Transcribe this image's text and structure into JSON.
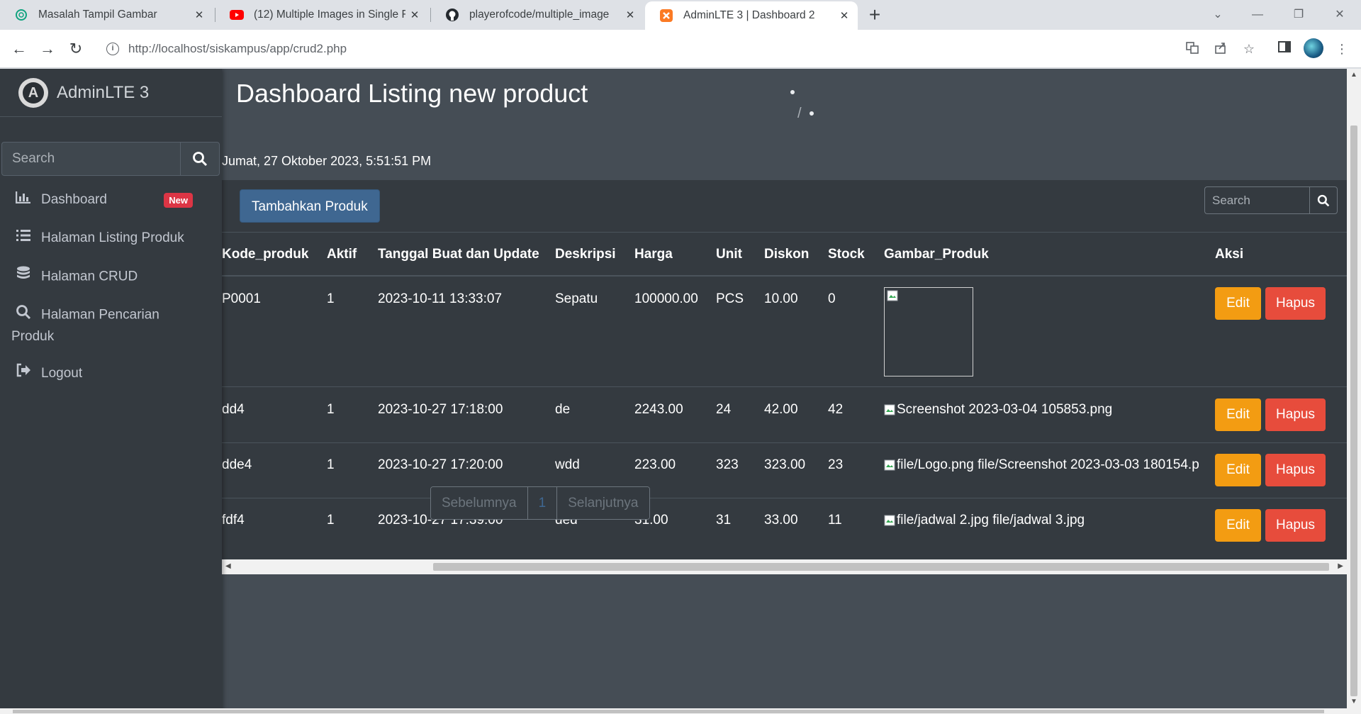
{
  "browser": {
    "tabs": [
      {
        "title": "Masalah Tampil Gambar",
        "icon": "chatgpt-icon"
      },
      {
        "title": "(12) Multiple Images in Single Fi",
        "icon": "youtube-icon"
      },
      {
        "title": "playerofcode/multiple_image",
        "icon": "github-icon"
      },
      {
        "title": "AdminLTE 3 | Dashboard 2",
        "icon": "xampp-icon",
        "active": true
      }
    ],
    "url_host": "http://localhost",
    "url_path": "/siskampus/app/crud2.php"
  },
  "sidebar": {
    "brand": "AdminLTE 3",
    "search_placeholder": "Search",
    "items": [
      {
        "label": "Dashboard",
        "icon": "chart-bar-icon",
        "badge": "New"
      },
      {
        "label": "Halaman Listing Produk",
        "icon": "list-icon"
      },
      {
        "label": "Halaman CRUD",
        "icon": "database-icon"
      },
      {
        "label": "Halaman Pencarian",
        "label2": "Produk",
        "icon": "search-icon"
      },
      {
        "label": "Logout",
        "icon": "sign-out-icon"
      }
    ]
  },
  "main": {
    "title": "Dashboard Listing new product",
    "breadcrumb_sep": "/",
    "datetime": "Jumat, 27 Oktober 2023, 5:51:51 PM",
    "add_button": "Tambahkan Produk",
    "search_placeholder": "Search",
    "columns": [
      "Kode_produk",
      "Aktif",
      "Tanggal Buat dan Update",
      "Deskripsi",
      "Harga",
      "Unit",
      "Diskon",
      "Stock",
      "Gambar_Produk",
      "Aksi"
    ],
    "rows": [
      {
        "kode": "P0001",
        "aktif": "1",
        "tanggal": "2023-10-11 13:33:07",
        "deskripsi": "Sepatu",
        "harga": "100000.00",
        "unit": "PCS",
        "diskon": "10.00",
        "stock": "0",
        "gambar": ""
      },
      {
        "kode": "dd4",
        "aktif": "1",
        "tanggal": "2023-10-27 17:18:00",
        "deskripsi": "de",
        "harga": "2243.00",
        "unit": "24",
        "diskon": "42.00",
        "stock": "42",
        "gambar": "Screenshot 2023-03-04 105853.png"
      },
      {
        "kode": "dde4",
        "aktif": "1",
        "tanggal": "2023-10-27 17:20:00",
        "deskripsi": "wdd",
        "harga": "223.00",
        "unit": "323",
        "diskon": "323.00",
        "stock": "23",
        "gambar": "file/Logo.png file/Screenshot 2023-03-03 180154.p"
      },
      {
        "kode": "fdf4",
        "aktif": "1",
        "tanggal": "2023-10-27 17:39:00",
        "deskripsi": "ded",
        "harga": "31.00",
        "unit": "31",
        "diskon": "33.00",
        "stock": "11",
        "gambar": "file/jadwal 2.jpg file/jadwal 3.jpg"
      }
    ],
    "edit_label": "Edit",
    "delete_label": "Hapus",
    "pagination": {
      "prev": "Sebelumnya",
      "page": "1",
      "next": "Selanjutnya"
    }
  },
  "colors": {
    "sidebar_bg": "#343a40",
    "content_bg": "#454d55",
    "primary": "#3f6791",
    "warning": "#f39c12",
    "danger": "#e74c3c",
    "badge": "#dc3545"
  }
}
